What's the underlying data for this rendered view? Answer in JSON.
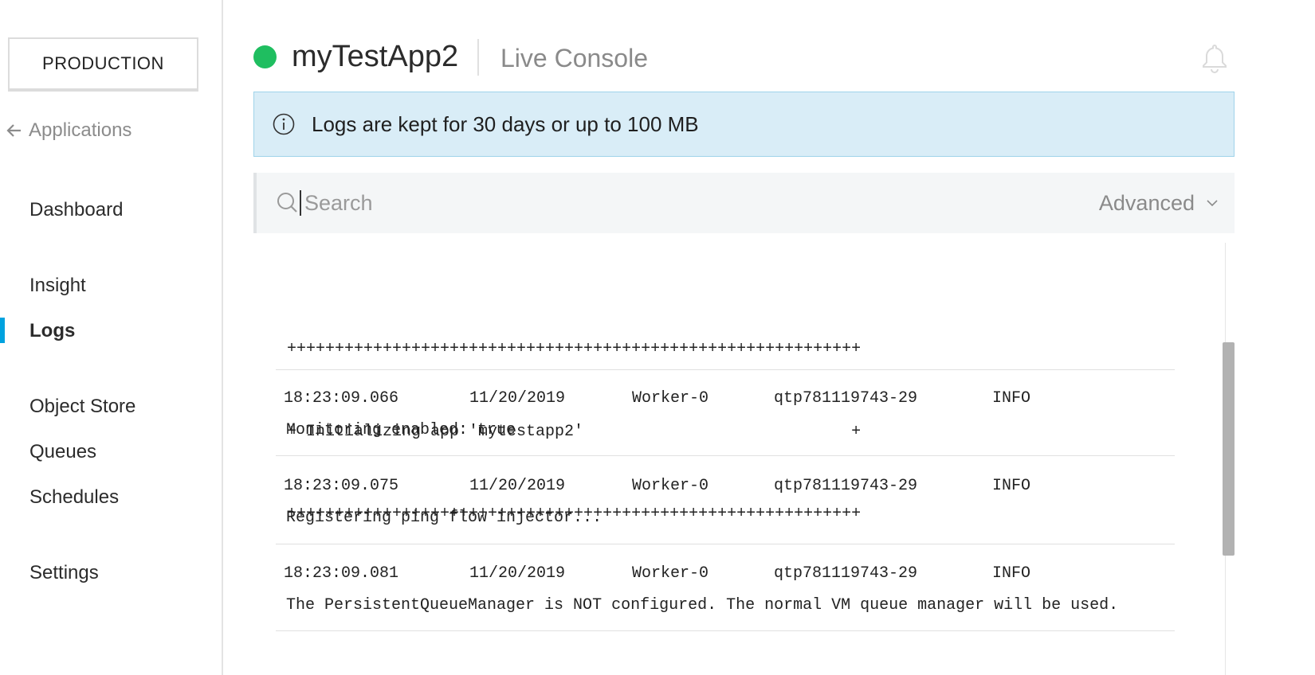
{
  "sidebar": {
    "environment": "PRODUCTION",
    "back_label": "Applications",
    "items": [
      {
        "label": "Dashboard"
      },
      {
        "label": "Insight"
      },
      {
        "label": "Logs"
      },
      {
        "label": "Object Store"
      },
      {
        "label": "Queues"
      },
      {
        "label": "Schedules"
      },
      {
        "label": "Settings"
      }
    ],
    "active_item": "Logs"
  },
  "header": {
    "app_name": "myTestApp2",
    "status_color": "#1fbe60",
    "section_title": "Live Console"
  },
  "banner": {
    "text": "Logs are kept for 30 days or up to 100 MB",
    "icon": "info-icon"
  },
  "search": {
    "placeholder": "Search",
    "value": "",
    "advanced_label": "Advanced"
  },
  "logs": {
    "startup_banner": [
      "++++++++++++++++++++++++++++++++++++++++++++++++++++++++++++",
      "+ Initializing app 'mytestapp2'                            +",
      "++++++++++++++++++++++++++++++++++++++++++++++++++++++++++++"
    ],
    "entries": [
      {
        "time": "18:23:09.066",
        "date": "11/20/2019",
        "worker": "Worker-0",
        "thread": "qtp781119743-29",
        "level": "INFO",
        "message": "Monitoring enabled: true"
      },
      {
        "time": "18:23:09.075",
        "date": "11/20/2019",
        "worker": "Worker-0",
        "thread": "qtp781119743-29",
        "level": "INFO",
        "message": "Registering ping flow injector..."
      },
      {
        "time": "18:23:09.081",
        "date": "11/20/2019",
        "worker": "Worker-0",
        "thread": "qtp781119743-29",
        "level": "INFO",
        "message": "The PersistentQueueManager is NOT configured. The normal VM queue manager will be used."
      }
    ]
  },
  "colors": {
    "accent": "#00a2df",
    "banner_bg": "#d9edf7",
    "status_running": "#1fbe60"
  }
}
